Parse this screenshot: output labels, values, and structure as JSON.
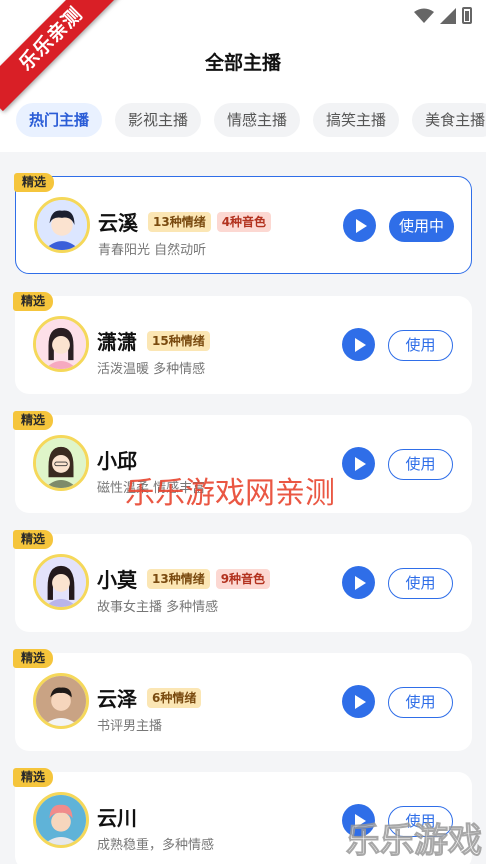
{
  "header": {
    "title": "全部主播"
  },
  "ribbon": "乐乐亲测",
  "tabs": [
    {
      "label": "热门主播",
      "active": true
    },
    {
      "label": "影视主播",
      "active": false
    },
    {
      "label": "情感主播",
      "active": false
    },
    {
      "label": "搞笑主播",
      "active": false
    },
    {
      "label": "美食主播",
      "active": false
    }
  ],
  "hosts": [
    {
      "badge": "精选",
      "name": "云溪",
      "emotion_tag": "13种情绪",
      "voice_tag": "4种音色",
      "desc": "青春阳光 自然动听",
      "button": "使用中",
      "selected": true
    },
    {
      "badge": "精选",
      "name": "潇潇",
      "emotion_tag": "15种情绪",
      "desc": "活泼温暖 多种情感",
      "button": "使用"
    },
    {
      "badge": "精选",
      "name": "小邱",
      "desc": "磁性温柔 情感丰富",
      "button": "使用"
    },
    {
      "badge": "精选",
      "name": "小莫",
      "emotion_tag": "13种情绪",
      "voice_tag": "9种音色",
      "desc": "故事女主播 多种情感",
      "button": "使用"
    },
    {
      "badge": "精选",
      "name": "云泽",
      "emotion_tag": "6种情绪",
      "desc": "书评男主播",
      "button": "使用"
    },
    {
      "badge": "精选",
      "name": "云川",
      "desc": "成熟稳重，多种情感",
      "button": "使用"
    }
  ],
  "watermark": {
    "center": "乐乐游戏网亲测",
    "corner": "乐乐游戏"
  },
  "colors": {
    "accent": "#2f6ee8",
    "badge": "#f5c53c",
    "emotion_tag_bg": "#fbe6b4",
    "voice_tag_bg": "#fcd8d2"
  }
}
